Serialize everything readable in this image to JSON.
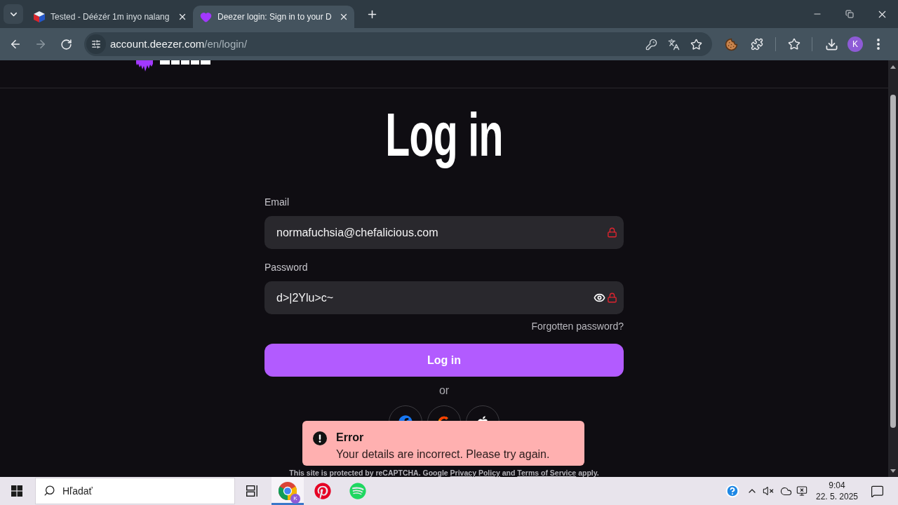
{
  "browser": {
    "tabs": [
      {
        "kind": "cube",
        "title": "Tested - Déézér 1m inyo nalang",
        "selected": false
      },
      {
        "kind": "heart",
        "title": "Deezer login: Sign in to your D",
        "selected": true
      }
    ],
    "toolbar": {
      "forward_disabled": true,
      "url": {
        "host": "account.deezer.com",
        "path": "/en/login/"
      },
      "profile_initial": "K"
    }
  },
  "page": {
    "title": "Log in",
    "fields": [
      {
        "kind": "email",
        "label": "Email",
        "value": "normafuchsia@chefalicious.com"
      },
      {
        "kind": "password",
        "label": "Password",
        "value": "d>|2Ylu>c~",
        "revealed": true
      }
    ],
    "forgot_link": "Forgotten password?",
    "submit_button": "Log in",
    "divider": "or",
    "social_buttons": [
      {
        "kind": "facebook"
      },
      {
        "kind": "google"
      },
      {
        "kind": "apple"
      }
    ],
    "recaptcha_notice": [
      {
        "kind": "text",
        "text": "This site is protected by reCAPTCHA. Google"
      },
      {
        "kind": "link",
        "text": "Privacy Policy"
      },
      {
        "kind": "text",
        "text": "and"
      },
      {
        "kind": "link",
        "text": "Terms of Service"
      },
      {
        "kind": "text",
        "text": "apply."
      }
    ]
  },
  "toast": {
    "kind": "error",
    "title": "Error",
    "message": "Your details are incorrect. Please try again."
  },
  "taskbar": {
    "search": {
      "placeholder": "Hľadať"
    },
    "apps": [
      {
        "kind": "chrome",
        "selected": true,
        "badge": "K"
      },
      {
        "kind": "pinterest",
        "selected": false
      },
      {
        "kind": "spotify",
        "selected": false
      }
    ],
    "volume_muted": true,
    "time": "9:04",
    "date": "22. 5. 2025"
  }
}
